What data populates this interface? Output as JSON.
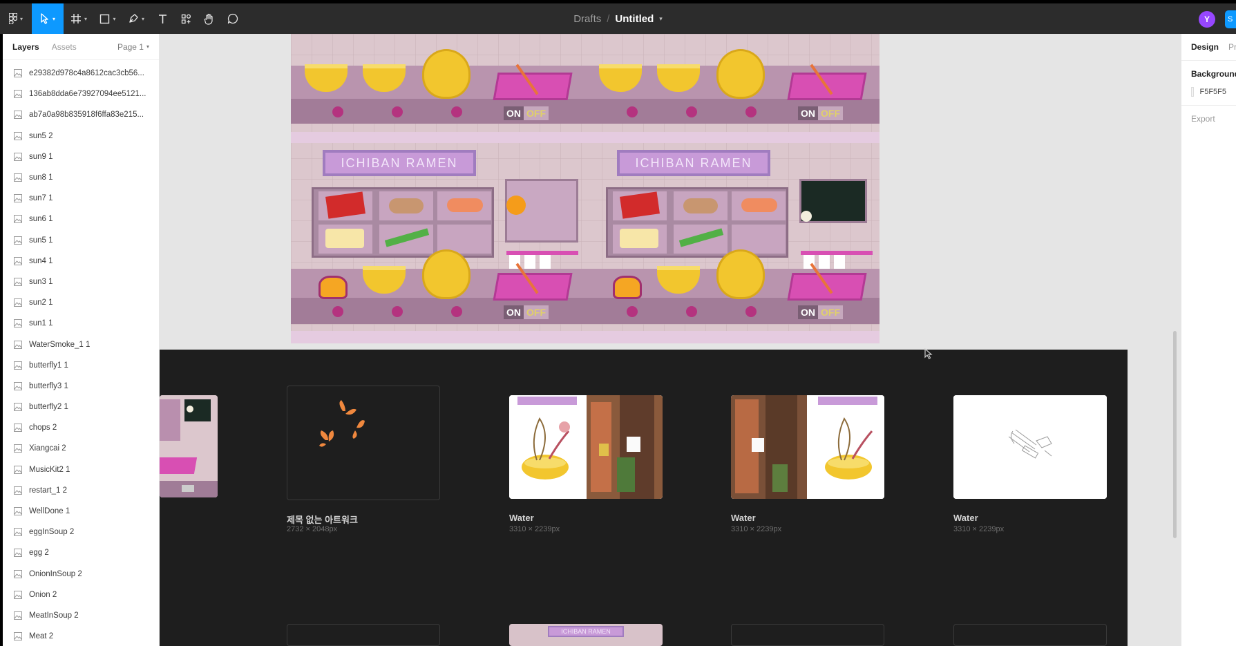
{
  "toolbar": {
    "breadcrumb_parent": "Drafts",
    "separator": "/",
    "file_title": "Untitled",
    "avatar_initial": "Y",
    "share_label": "S"
  },
  "left_panel": {
    "tab_layers": "Layers",
    "tab_assets": "Assets",
    "page": "Page 1",
    "layers": [
      "e29382d978c4a8612cac3cb56...",
      "136ab8dda6e73927094ee5121...",
      "ab7a0a98b835918f6ffa83e215...",
      "sun5 2",
      "sun9 1",
      "sun8 1",
      "sun7 1",
      "sun6 1",
      "sun5 1",
      "sun4 1",
      "sun3 1",
      "sun2 1",
      "sun1 1",
      "WaterSmoke_1 1",
      "butterfly1 1",
      "butterfly3 1",
      "butterfly2 1",
      "chops 2",
      "Xiangcai 2",
      "MusicKit2 1",
      "restart_1 2",
      "WellDone 1",
      "eggInSoup 2",
      "egg 2",
      "OnionInSoup 2",
      "Onion 2",
      "MeatInSoup 2",
      "Meat 2"
    ]
  },
  "canvas": {
    "artwork": {
      "sign_text": "ICHIBAN RAMEN",
      "switch_on": "ON",
      "switch_off": "OFF"
    },
    "thumbnails": [
      {
        "title": "제목 없는 아트워크",
        "size": "2732 × 2048px"
      },
      {
        "title": "Water",
        "size": "3310 × 2239px"
      },
      {
        "title": "Water",
        "size": "3310 × 2239px"
      },
      {
        "title": "Water",
        "size": "3310 × 2239px"
      }
    ]
  },
  "right_panel": {
    "tab_design": "Design",
    "tab_prototype": "Pr",
    "background_label": "Background",
    "background_value": "F5F5F5",
    "export_label": "Export"
  },
  "colors": {
    "toolbar_bg": "#2c2c2c",
    "accent": "#0d99ff",
    "avatar": "#9747ff",
    "dark_frame": "#1e1e1e",
    "canvas_bg": "#e5e5e5"
  }
}
